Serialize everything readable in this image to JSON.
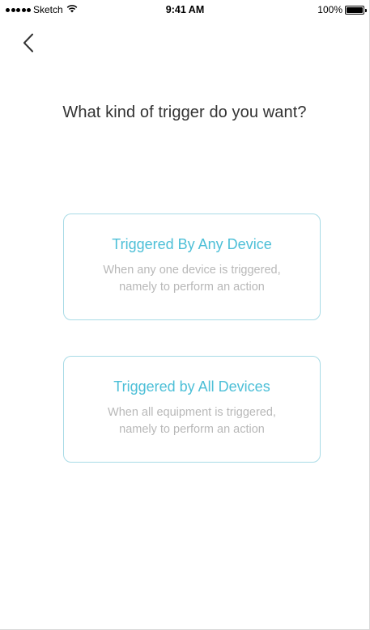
{
  "status_bar": {
    "carrier": "Sketch",
    "time": "9:41 AM",
    "battery": "100%"
  },
  "nav": {
    "back_icon": "chevron-left-icon"
  },
  "page": {
    "title": "What kind of trigger do you want?"
  },
  "options": [
    {
      "title": "Triggered By Any Device",
      "desc_line1": "When any one device is triggered,",
      "desc_line2": "namely to perform an action"
    },
    {
      "title": "Triggered by All Devices",
      "desc_line1": "When all equipment is triggered,",
      "desc_line2": "namely to perform an action"
    }
  ],
  "colors": {
    "accent": "#4cbfd7",
    "card_border": "#a8dbe6",
    "description": "#b8b8b8",
    "title": "#333333"
  }
}
